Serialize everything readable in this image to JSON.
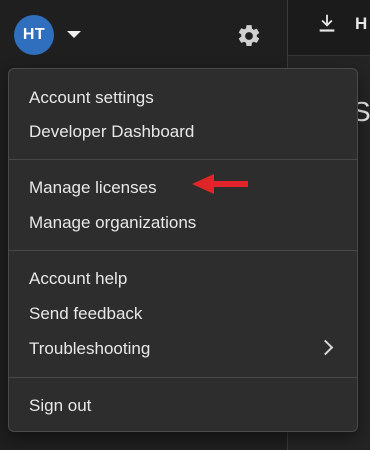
{
  "header": {
    "avatar_initials": "HT",
    "avatar_color": "#2f6fbd",
    "caret_icon": "caret-down-icon",
    "settings_icon": "gear-icon"
  },
  "right_panel": {
    "download_icon": "download-icon",
    "partial_title_letter": "H",
    "partial_heading_letter": "S"
  },
  "menu": {
    "groups": [
      {
        "items": [
          {
            "label": "Account settings"
          },
          {
            "label": "Developer Dashboard"
          }
        ]
      },
      {
        "items": [
          {
            "label": "Manage licenses"
          },
          {
            "label": "Manage organizations"
          }
        ]
      },
      {
        "items": [
          {
            "label": "Account help"
          },
          {
            "label": "Send feedback"
          },
          {
            "label": "Troubleshooting",
            "has_submenu": true,
            "submenu_icon": "chevron-right-icon"
          }
        ]
      },
      {
        "items": [
          {
            "label": "Sign out"
          }
        ]
      }
    ]
  },
  "annotation": {
    "type": "red-arrow",
    "points_to": "Manage licenses",
    "color": "#e0242a"
  }
}
